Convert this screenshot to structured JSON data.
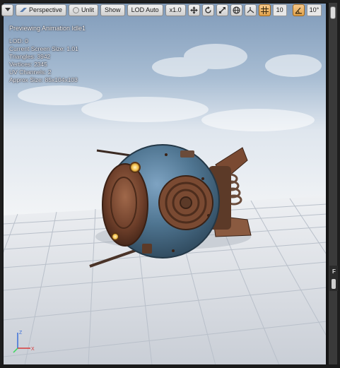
{
  "toolbar": {
    "menu_icon": "dropdown-arrow-icon",
    "perspective_label": "Perspective",
    "unlit_label": "Unlit",
    "show_label": "Show",
    "lod_label": "LOD Auto",
    "speed_label": "x1.0",
    "grid_snap_value": "10",
    "angle_snap_value": "10°",
    "accent_color": "#e0a24c"
  },
  "viewport": {
    "title": "Previewing Animation Idle1",
    "stats": [
      "LOD: 0",
      "Current Screen Size: 1.01",
      "Triangles: 3942",
      "Vertices: 2345",
      "UV Channels: 2",
      "Approx Size: 85x104x103"
    ],
    "axis_labels": {
      "z": "Z",
      "x": "X"
    }
  },
  "side_panel": {
    "tab_label": "F"
  }
}
